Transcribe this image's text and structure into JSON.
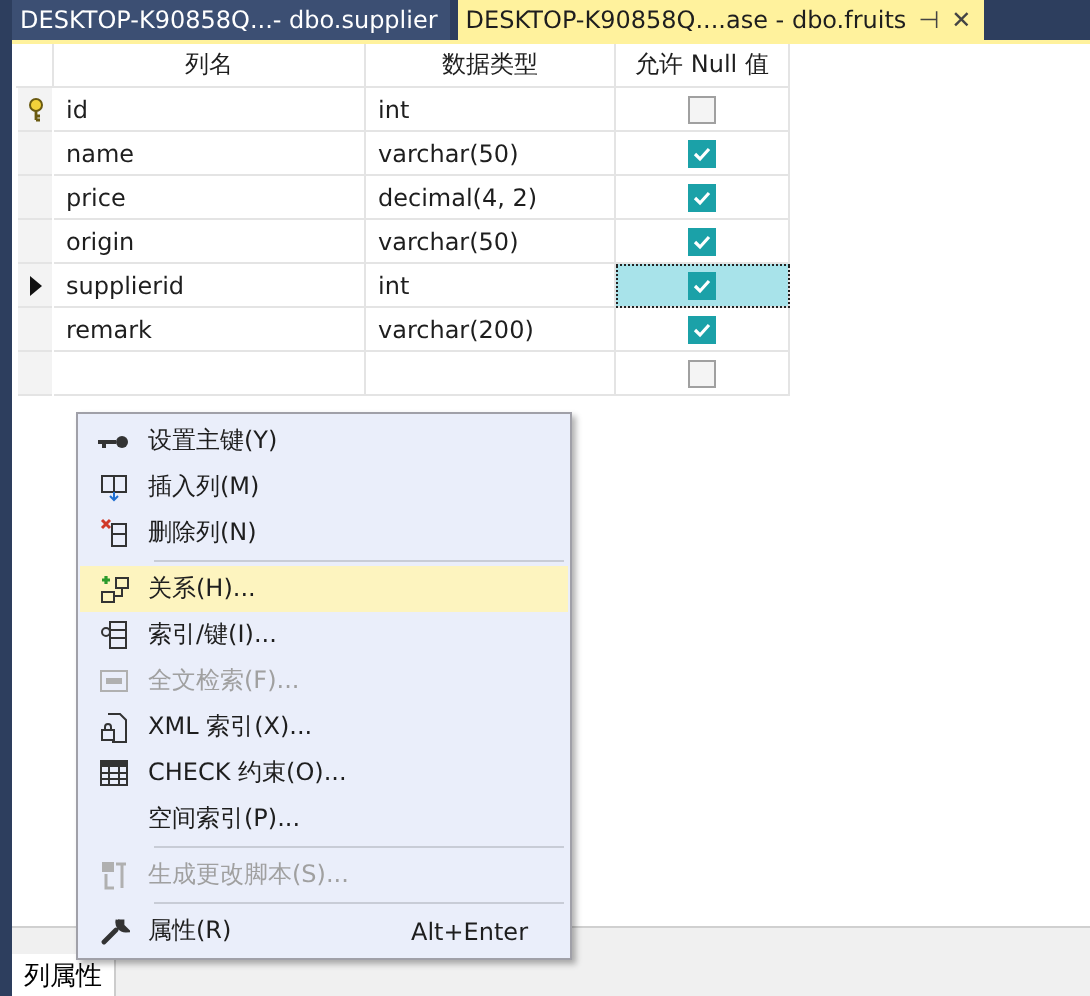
{
  "tabs": [
    {
      "label": "DESKTOP-K90858Q...- dbo.supplier",
      "selected": false
    },
    {
      "label": "DESKTOP-K90858Q....ase - dbo.fruits",
      "selected": true
    }
  ],
  "tab_actions": {
    "pin": "⊣",
    "close": "✕"
  },
  "table": {
    "columns": [
      "列名",
      "数据类型",
      "允许 Null 值"
    ],
    "rows": [
      {
        "name": "id",
        "type": "int",
        "allow_null": false,
        "primary_key": true,
        "selected": false
      },
      {
        "name": "name",
        "type": "varchar(50)",
        "allow_null": true,
        "primary_key": false,
        "selected": false
      },
      {
        "name": "price",
        "type": "decimal(4, 2)",
        "allow_null": true,
        "primary_key": false,
        "selected": false
      },
      {
        "name": "origin",
        "type": "varchar(50)",
        "allow_null": true,
        "primary_key": false,
        "selected": false
      },
      {
        "name": "supplierid",
        "type": "int",
        "allow_null": true,
        "primary_key": false,
        "selected": true
      },
      {
        "name": "remark",
        "type": "varchar(200)",
        "allow_null": true,
        "primary_key": false,
        "selected": false
      },
      {
        "allow_null": false,
        "primary_key": false,
        "selected": false
      }
    ]
  },
  "context_menu": [
    {
      "kind": "item",
      "label": "设置主键(Y)",
      "disabled": false,
      "selected": false
    },
    {
      "kind": "item",
      "label": "插入列(M)",
      "disabled": false,
      "selected": false
    },
    {
      "kind": "item",
      "label": "删除列(N)",
      "disabled": false,
      "selected": false
    },
    {
      "kind": "separator"
    },
    {
      "kind": "item",
      "label": "关系(H)...",
      "disabled": false,
      "selected": true
    },
    {
      "kind": "item",
      "label": "索引/键(I)...",
      "disabled": false,
      "selected": false
    },
    {
      "kind": "item",
      "label": "全文检索(F)...",
      "disabled": true,
      "selected": false
    },
    {
      "kind": "item",
      "label": "XML 索引(X)...",
      "disabled": false,
      "selected": false
    },
    {
      "kind": "item",
      "label": "CHECK 约束(O)...",
      "disabled": false,
      "selected": false
    },
    {
      "kind": "item",
      "label": "空间索引(P)...",
      "disabled": false,
      "selected": false
    },
    {
      "kind": "separator"
    },
    {
      "kind": "item",
      "label": "生成更改脚本(S)...",
      "disabled": true,
      "selected": false
    },
    {
      "kind": "separator"
    },
    {
      "kind": "item",
      "label": "属性(R)",
      "shortcut": "Alt+Enter",
      "disabled": false,
      "selected": false
    }
  ],
  "bottom_tab": "列属性"
}
